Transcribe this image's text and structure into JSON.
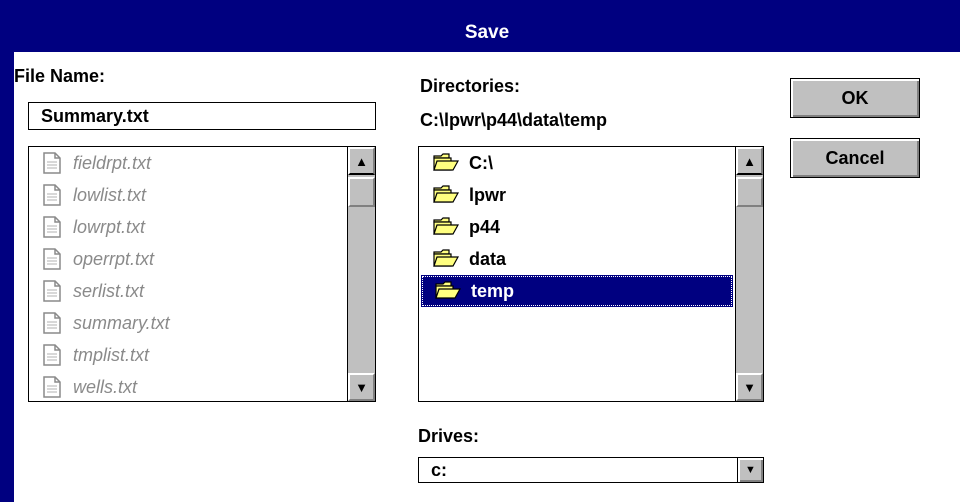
{
  "window": {
    "title": "Save"
  },
  "file_name": {
    "label": "File Name:",
    "value": "Summary.txt"
  },
  "files": [
    {
      "name": "fieldrpt.txt",
      "icon": "text-file-icon"
    },
    {
      "name": "lowlist.txt",
      "icon": "text-file-icon"
    },
    {
      "name": "lowrpt.txt",
      "icon": "text-file-icon"
    },
    {
      "name": "operrpt.txt",
      "icon": "text-file-icon"
    },
    {
      "name": "serlist.txt",
      "icon": "text-file-icon"
    },
    {
      "name": "summary.txt",
      "icon": "text-file-icon"
    },
    {
      "name": "tmplist.txt",
      "icon": "text-file-icon"
    },
    {
      "name": "wells.txt",
      "icon": "text-file-icon"
    }
  ],
  "directories": {
    "label": "Directories:",
    "current_path": "C:\\lpwr\\p44\\data\\temp",
    "items": [
      {
        "name": "C:\\",
        "icon": "open-folder-icon",
        "selected": false
      },
      {
        "name": "lpwr",
        "icon": "open-folder-icon",
        "selected": false
      },
      {
        "name": "p44",
        "icon": "open-folder-icon",
        "selected": false
      },
      {
        "name": "data",
        "icon": "open-folder-icon",
        "selected": false
      },
      {
        "name": "temp",
        "icon": "open-folder-icon",
        "selected": true
      }
    ]
  },
  "drives": {
    "label": "Drives:",
    "value": "c:"
  },
  "buttons": {
    "ok": "OK",
    "cancel": "Cancel"
  },
  "scrollbar_glyphs": {
    "up": "▲",
    "down": "▼"
  },
  "colors": {
    "title_bar": "#000080",
    "selection": "#000080",
    "button_face": "#c0c0c0",
    "disabled_text": "#8a8a8a",
    "folder": "#ffff80"
  }
}
